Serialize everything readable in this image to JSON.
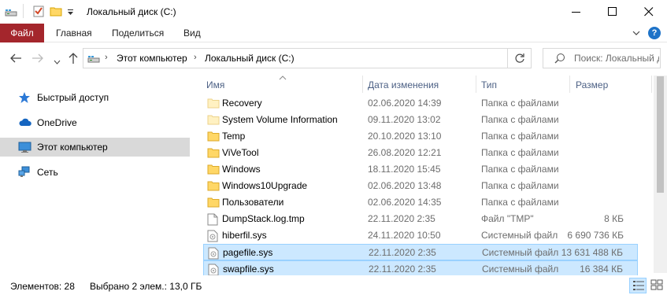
{
  "window": {
    "title": "Локальный диск (C:)"
  },
  "ribbon": {
    "tabs": [
      {
        "label": "Файл"
      },
      {
        "label": "Главная"
      },
      {
        "label": "Поделиться"
      },
      {
        "label": "Вид"
      }
    ]
  },
  "address": {
    "segments": [
      "Этот компьютер",
      "Локальный диск (C:)"
    ],
    "search_placeholder": "Поиск: Локальный диск (C:)"
  },
  "nav_pane": {
    "items": [
      {
        "label": "Быстрый доступ",
        "icon": "star-icon"
      },
      {
        "label": "OneDrive",
        "icon": "cloud-icon"
      },
      {
        "label": "Этот компьютер",
        "icon": "computer-icon",
        "selected": true
      },
      {
        "label": "Сеть",
        "icon": "network-icon"
      }
    ]
  },
  "columns": {
    "name": "Имя",
    "date": "Дата изменения",
    "type": "Тип",
    "size": "Размер"
  },
  "files": [
    {
      "name": "Recovery",
      "date": "02.06.2020 14:39",
      "type": "Папка с файлами",
      "size": "",
      "icon": "folder-hidden-icon",
      "selected": false
    },
    {
      "name": "System Volume Information",
      "date": "09.11.2020 13:02",
      "type": "Папка с файлами",
      "size": "",
      "icon": "folder-hidden-icon",
      "selected": false
    },
    {
      "name": "Temp",
      "date": "20.10.2020 13:10",
      "type": "Папка с файлами",
      "size": "",
      "icon": "folder-icon",
      "selected": false
    },
    {
      "name": "ViVeTool",
      "date": "26.08.2020 12:21",
      "type": "Папка с файлами",
      "size": "",
      "icon": "folder-icon",
      "selected": false
    },
    {
      "name": "Windows",
      "date": "18.11.2020 15:45",
      "type": "Папка с файлами",
      "size": "",
      "icon": "folder-icon",
      "selected": false
    },
    {
      "name": "Windows10Upgrade",
      "date": "02.06.2020 13:48",
      "type": "Папка с файлами",
      "size": "",
      "icon": "folder-icon",
      "selected": false
    },
    {
      "name": "Пользователи",
      "date": "02.06.2020 14:35",
      "type": "Папка с файлами",
      "size": "",
      "icon": "folder-icon",
      "selected": false
    },
    {
      "name": "DumpStack.log.tmp",
      "date": "22.11.2020 2:35",
      "type": "Файл \"TMP\"",
      "size": "8 КБ",
      "icon": "file-icon",
      "selected": false
    },
    {
      "name": "hiberfil.sys",
      "date": "24.11.2020 10:50",
      "type": "Системный файл",
      "size": "6 690 736 КБ",
      "icon": "system-file-icon",
      "selected": false
    },
    {
      "name": "pagefile.sys",
      "date": "22.11.2020 2:35",
      "type": "Системный файл",
      "size": "13 631 488 КБ",
      "icon": "system-file-icon",
      "selected": true
    },
    {
      "name": "swapfile.sys",
      "date": "22.11.2020 2:35",
      "type": "Системный файл",
      "size": "16 384 КБ",
      "icon": "system-file-icon",
      "selected": true
    }
  ],
  "status": {
    "items_count": "Элементов: 28",
    "selected_info": "Выбрано 2 элем.: 13,0 ГБ"
  },
  "colors": {
    "file_tab": "#a4262c",
    "selection_bg": "#cce8ff",
    "selection_border": "#99d1ff",
    "folder": "#ffd766"
  }
}
